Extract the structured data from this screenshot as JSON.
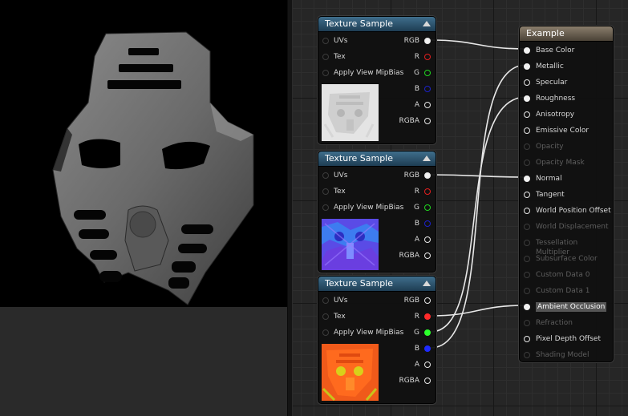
{
  "viewport": {
    "label": "material-preview-viewport"
  },
  "texture_nodes": [
    {
      "title": "Texture Sample",
      "inputs": [
        "UVs",
        "Tex",
        "Apply View MipBias"
      ],
      "outputs": [
        "RGB",
        "R",
        "G",
        "B",
        "A",
        "RGBA"
      ],
      "thumbnail": "base-color-texture"
    },
    {
      "title": "Texture Sample",
      "inputs": [
        "UVs",
        "Tex",
        "Apply View MipBias"
      ],
      "outputs": [
        "RGB",
        "R",
        "G",
        "B",
        "A",
        "RGBA"
      ],
      "thumbnail": "normal-map-texture"
    },
    {
      "title": "Texture Sample",
      "inputs": [
        "UVs",
        "Tex",
        "Apply View MipBias"
      ],
      "outputs": [
        "RGB",
        "R",
        "G",
        "B",
        "A",
        "RGBA"
      ],
      "thumbnail": "orm-packed-texture"
    }
  ],
  "result_node": {
    "title": "Example",
    "inputs": [
      {
        "label": "Base Color",
        "enabled": true,
        "connected": true
      },
      {
        "label": "Metallic",
        "enabled": true,
        "connected": true
      },
      {
        "label": "Specular",
        "enabled": true,
        "connected": false
      },
      {
        "label": "Roughness",
        "enabled": true,
        "connected": true
      },
      {
        "label": "Anisotropy",
        "enabled": true,
        "connected": false
      },
      {
        "label": "Emissive Color",
        "enabled": true,
        "connected": false
      },
      {
        "label": "Opacity",
        "enabled": false,
        "connected": false
      },
      {
        "label": "Opacity Mask",
        "enabled": false,
        "connected": false
      },
      {
        "label": "Normal",
        "enabled": true,
        "connected": true
      },
      {
        "label": "Tangent",
        "enabled": true,
        "connected": false
      },
      {
        "label": "World Position Offset",
        "enabled": true,
        "connected": false
      },
      {
        "label": "World Displacement",
        "enabled": false,
        "connected": false
      },
      {
        "label": "Tessellation Multiplier",
        "enabled": false,
        "connected": false
      },
      {
        "label": "Subsurface Color",
        "enabled": false,
        "connected": false
      },
      {
        "label": "Custom Data 0",
        "enabled": false,
        "connected": false
      },
      {
        "label": "Custom Data 1",
        "enabled": false,
        "connected": false
      },
      {
        "label": "Ambient Occlusion",
        "enabled": true,
        "connected": true
      },
      {
        "label": "Refraction",
        "enabled": false,
        "connected": false
      },
      {
        "label": "Pixel Depth Offset",
        "enabled": true,
        "connected": false
      },
      {
        "label": "Shading Model",
        "enabled": false,
        "connected": false
      }
    ]
  },
  "colors": {
    "texture_header": "#2f5673",
    "result_header": "#6d6354",
    "wire": "#e8e8e8",
    "pin_red": "#ff2a2a",
    "pin_green": "#2bff2b",
    "pin_blue": "#1f2bff"
  }
}
